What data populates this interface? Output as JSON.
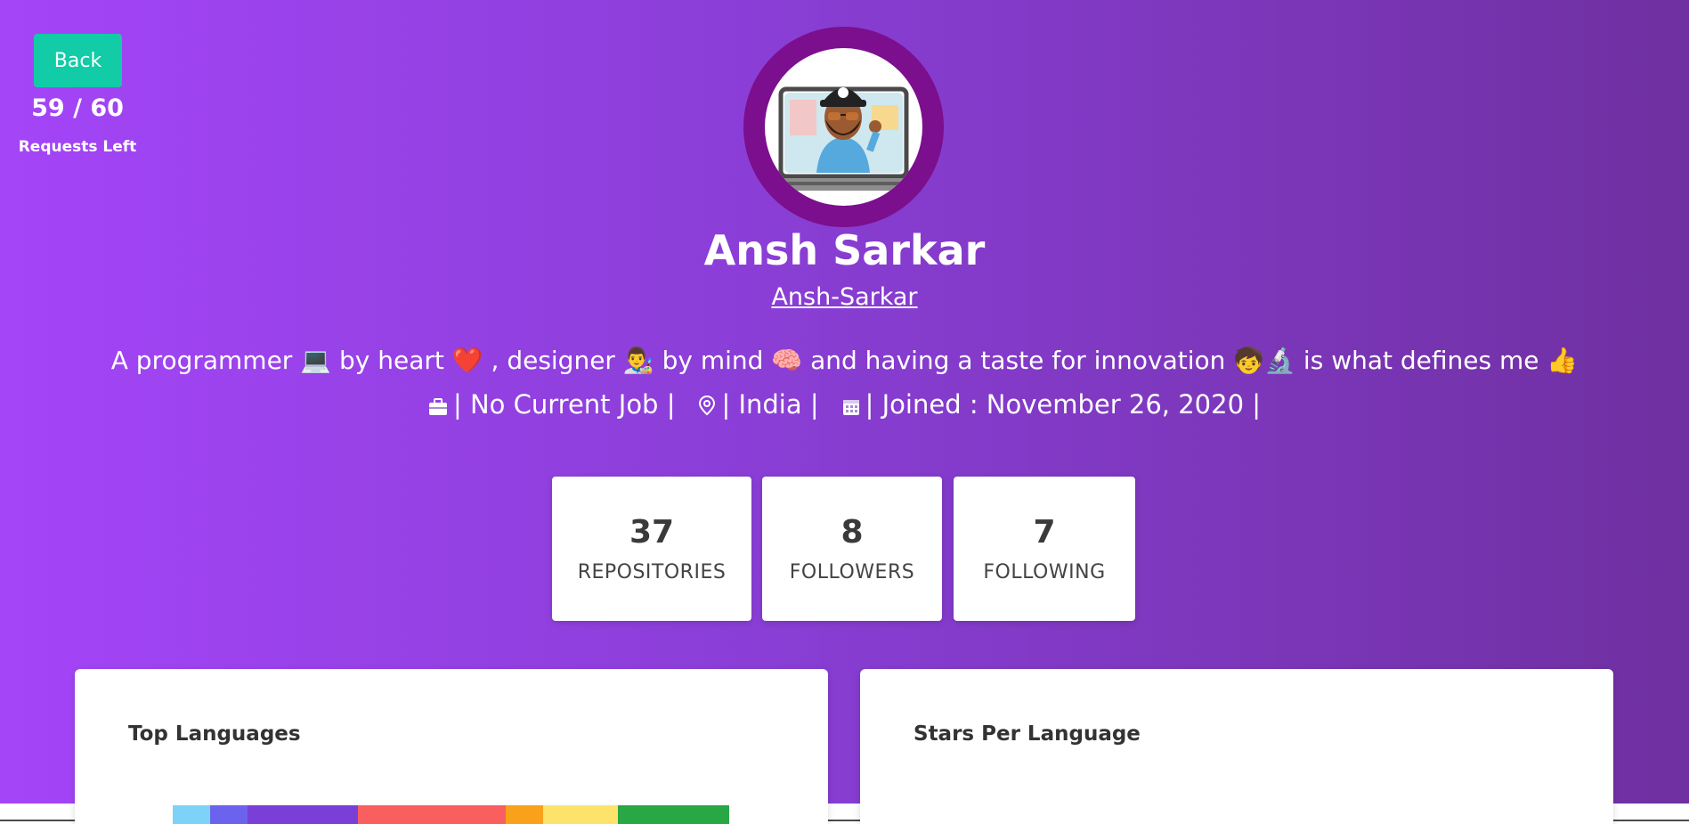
{
  "rate_limit": {
    "back_label": "Back",
    "count": "59 / 60",
    "label": "Requests Left"
  },
  "profile": {
    "name": "Ansh Sarkar",
    "username": "Ansh-Sarkar",
    "bio": "A programmer 💻 by heart ❤️ , designer 👨‍🎨 by mind 🧠 and having a taste for innovation 🧒🔬 is what defines me 👍",
    "job": "| No Current Job |",
    "location": "| India |",
    "joined": "| Joined : November 26, 2020 |"
  },
  "stats": [
    {
      "value": "37",
      "label": "REPOSITORIES"
    },
    {
      "value": "8",
      "label": "FOLLOWERS"
    },
    {
      "value": "7",
      "label": "FOLLOWING"
    }
  ],
  "panels": {
    "top_languages": "Top Languages",
    "stars_per_language": "Stars Per Language"
  },
  "language_bar_colors": [
    "#7dd3f7",
    "#6b63ee",
    "#7a3fd6",
    "#f95f5f",
    "#f9a11a",
    "#fde36c",
    "#28a745"
  ],
  "icons": [
    "briefcase-icon",
    "location-pin-icon",
    "calendar-icon"
  ],
  "colors": {
    "accent": "#12cba7",
    "avatar_ring": "#7b0f8d",
    "gradient_start": "#a445f8",
    "gradient_end": "#6f30a1"
  }
}
